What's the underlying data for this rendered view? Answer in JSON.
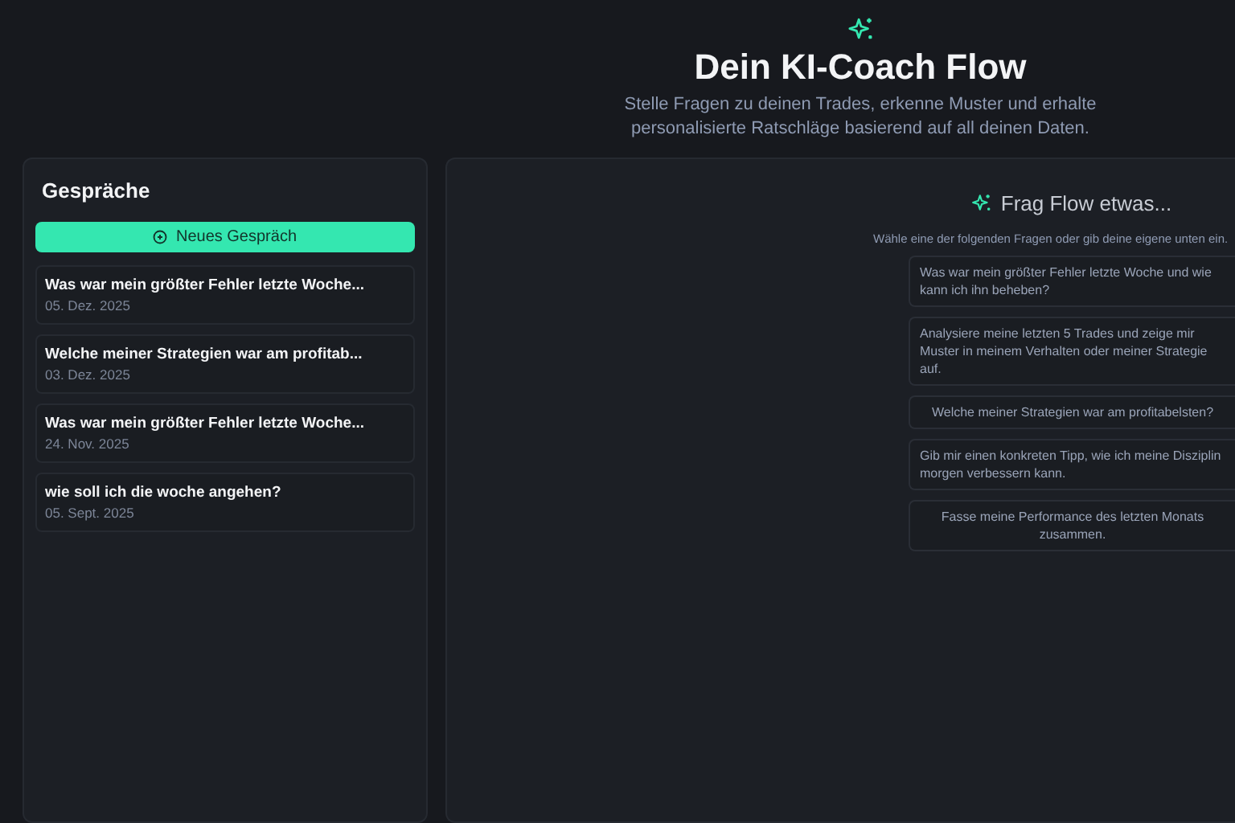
{
  "header": {
    "title": "Dein KI-Coach Flow",
    "subtitle": "Stelle Fragen zu deinen Trades, erkenne Muster und erhalte personalisierte Ratschläge basierend auf all deinen Daten."
  },
  "sidebar": {
    "title": "Gespräche",
    "new_button": "Neues Gespräch",
    "conversations": [
      {
        "title": "Was war mein größter Fehler letzte Woche...",
        "date": "05. Dez. 2025"
      },
      {
        "title": "Welche meiner Strategien war am profitab...",
        "date": "03. Dez. 2025"
      },
      {
        "title": "Was war mein größter Fehler letzte Woche...",
        "date": "24. Nov. 2025"
      },
      {
        "title": "wie soll ich die woche angehen?",
        "date": "05. Sept. 2025"
      }
    ]
  },
  "chat": {
    "prompt_title": "Frag Flow etwas...",
    "prompt_hint": "Wähle eine der folgenden Fragen oder gib deine eigene unten ein.",
    "suggestions": [
      {
        "text": "Was war mein größter Fehler letzte Woche und wie kann ich ihn beheben?",
        "centered": false
      },
      {
        "text": "Analysiere meine letzten 5 Trades und zeige mir Muster in meinem Verhalten oder meiner Strategie auf.",
        "centered": false
      },
      {
        "text": "Welche meiner Strategien war am profitabelsten?",
        "centered": true
      },
      {
        "text": "Gib mir einen konkreten Tipp, wie ich meine Disziplin morgen verbessern kann.",
        "centered": false
      },
      {
        "text": "Fasse meine Performance des letzten Monats zusammen.",
        "centered": true
      }
    ]
  }
}
